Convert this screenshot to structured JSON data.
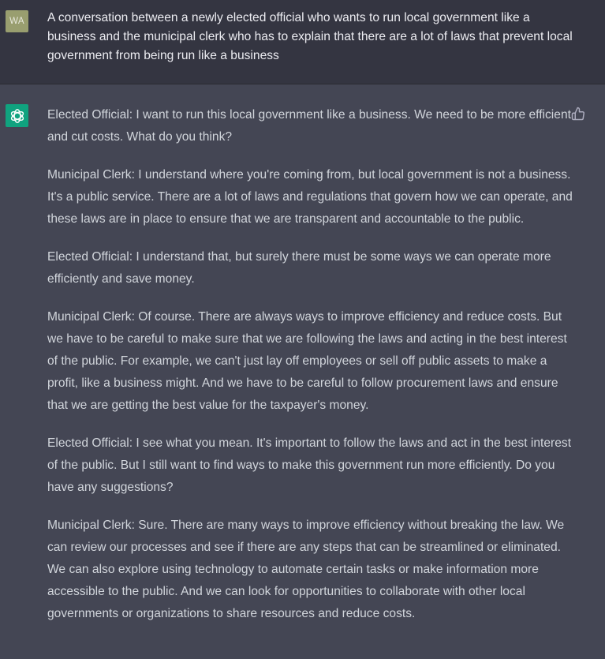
{
  "user": {
    "initials": "WA",
    "message": "A conversation between a newly elected official who wants to run local government like a business and the municipal clerk who has to explain that there are a lot of laws that prevent local government from being run like a business"
  },
  "assistant": {
    "avatar_icon": "openai-logo-icon",
    "feedback_icon": "thumbs-up-icon",
    "paragraphs": [
      "Elected Official: I want to run this local government like a business. We need to be more efficient and cut costs. What do you think?",
      "Municipal Clerk: I understand where you're coming from, but local government is not a business. It's a public service. There are a lot of laws and regulations that govern how we can operate, and these laws are in place to ensure that we are transparent and accountable to the public.",
      "Elected Official: I understand that, but surely there must be some ways we can operate more efficiently and save money.",
      "Municipal Clerk: Of course. There are always ways to improve efficiency and reduce costs. But we have to be careful to make sure that we are following the laws and acting in the best interest of the public. For example, we can't just lay off employees or sell off public assets to make a profit, like a business might. And we have to be careful to follow procurement laws and ensure that we are getting the best value for the taxpayer's money.",
      "Elected Official: I see what you mean. It's important to follow the laws and act in the best interest of the public. But I still want to find ways to make this government run more efficiently. Do you have any suggestions?",
      "Municipal Clerk: Sure. There are many ways to improve efficiency without breaking the law. We can review our processes and see if there are any steps that can be streamlined or eliminated. We can also explore using technology to automate certain tasks or make information more accessible to the public. And we can look for opportunities to collaborate with other local governments or organizations to share resources and reduce costs."
    ]
  },
  "colors": {
    "user_bg": "#343541",
    "assistant_bg": "#444654",
    "user_avatar": "#999e6f",
    "bot_avatar": "#10a37f",
    "text": "#d1d5db"
  }
}
